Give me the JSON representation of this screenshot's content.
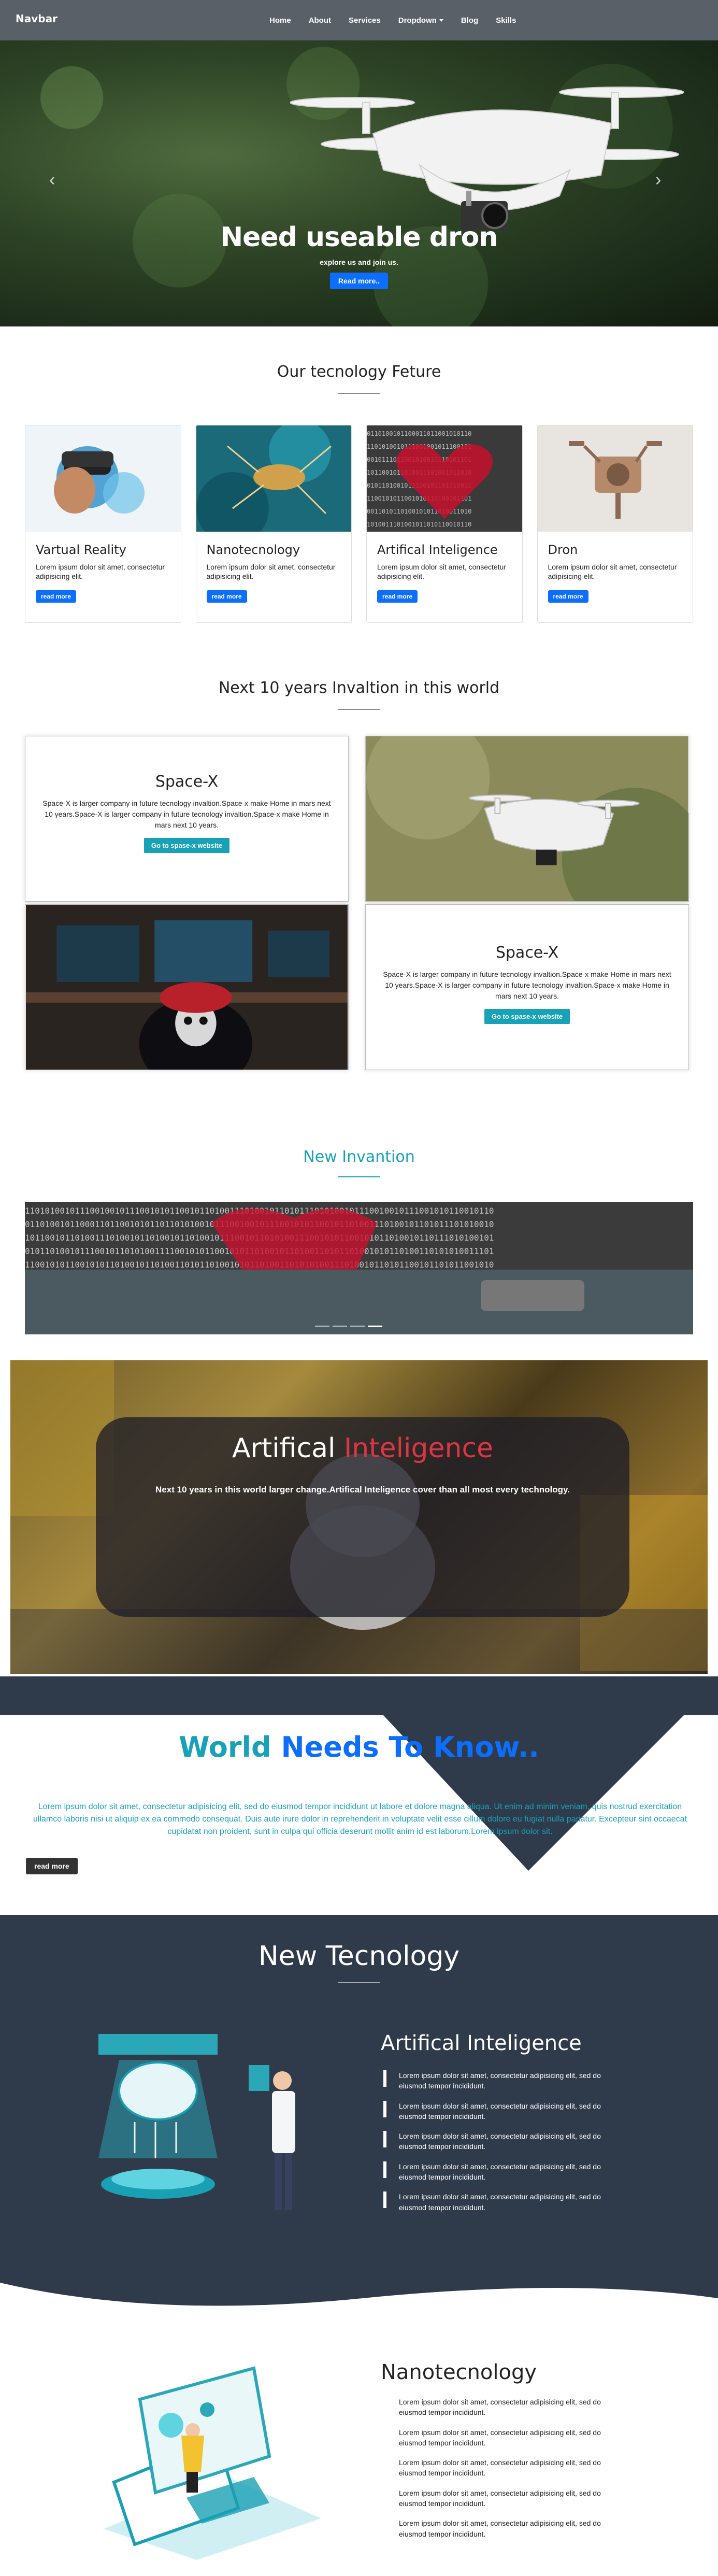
{
  "navbar": {
    "brand": "Navbar",
    "links": [
      "Home",
      "About",
      "Services",
      "Dropdown",
      "Blog",
      "Skills"
    ]
  },
  "hero": {
    "title": "Need useable dron",
    "subtitle": "explore us and join us.",
    "button": "Read more.."
  },
  "features": {
    "title": "Our tecnology Feture",
    "cards": [
      {
        "title": "Vartual Reality",
        "text": "Lorem ipsum dolor sit amet, consectetur adipisicing elit.",
        "button": "read more"
      },
      {
        "title": "Nanotecnology",
        "text": "Lorem ipsum dolor sit amet, consectetur adipisicing elit.",
        "button": "read more"
      },
      {
        "title": "Artifical Inteligence",
        "text": "Lorem ipsum dolor sit amet, consectetur adipisicing elit.",
        "button": "read more"
      },
      {
        "title": "Dron",
        "text": "Lorem ipsum dolor sit amet, consectetur adipisicing elit.",
        "button": "read more"
      }
    ]
  },
  "invasion": {
    "title": "Next 10 years Invaltion in this world",
    "box1": {
      "title": "Space-X",
      "text": "Space-X is larger company in future tecnology invaltion.Space-x make Home in mars next 10 years.Space-X is larger company in future tecnology invaltion.Space-x make Home in mars next 10 years.",
      "button": "Go to spase-x website"
    },
    "box2": {
      "title": "Space-X",
      "text": "Space-X is larger company in future tecnology invaltion.Space-x make Home in mars next 10 years.Space-X is larger company in future tecnology invaltion.Space-x make Home in mars next 10 years.",
      "button": "Go to spase-x website"
    }
  },
  "new_invantion": {
    "title": "New Invantion"
  },
  "ai_banner": {
    "title_white": "Artifical",
    "title_red": "Inteligence",
    "text": "Next 10 years in this world larger change.Artifical Inteligence cover than all most every technology."
  },
  "world_needs": {
    "word1": "World",
    "word2": "Needs To Know..",
    "text": "Lorem ipsum dolor sit amet, consectetur adipisicing elit, sed do eiusmod tempor incididunt ut labore et dolore magna aliqua. Ut enim ad minim veniam, quis nostrud exercitation ullamco laboris nisi ut aliquip ex ea commodo consequat. Duis aute irure dolor in reprehenderit in voluptate velit esse cillum dolore eu fugiat nulla pariatur. Excepteur sint occaecat cupidatat non proident, sunt in culpa qui officia deserunt mollit anim id est laborum.Lorem ipsum dolor sit.",
    "button": "read more"
  },
  "new_tech": {
    "title": "New Tecnology",
    "ai": {
      "title": "Artifical Inteligence",
      "items": [
        "Lorem ipsum dolor sit amet, consectetur adipisicing elit, sed do eiusmod tempor incididunt.",
        "Lorem ipsum dolor sit amet, consectetur adipisicing elit, sed do eiusmod tempor incididunt.",
        "Lorem ipsum dolor sit amet, consectetur adipisicing elit, sed do eiusmod tempor incididunt.",
        "Lorem ipsum dolor sit amet, consectetur adipisicing elit, sed do eiusmod tempor incididunt.",
        "Lorem ipsum dolor sit amet, consectetur adipisicing elit, sed do eiusmod tempor incididunt."
      ]
    },
    "nano": {
      "title": "Nanotecnology",
      "items": [
        "Lorem ipsum dolor sit amet, consectetur adipisicing elit, sed do eiusmod tempor incididunt.",
        "Lorem ipsum dolor sit amet, consectetur adipisicing elit, sed do eiusmod tempor incididunt.",
        "Lorem ipsum dolor sit amet, consectetur adipisicing elit, sed do eiusmod tempor incididunt.",
        "Lorem ipsum dolor sit amet, consectetur adipisicing elit, sed do eiusmod tempor incididunt.",
        "Lorem ipsum dolor sit amet, consectetur adipisicing elit, sed do eiusmod tempor incididunt."
      ]
    }
  },
  "colors": {
    "navbar": "#5a6068",
    "primary": "#0d6efd",
    "teal": "#17a2b8",
    "dark_section": "#2f3b4b",
    "red": "#dc3545"
  }
}
